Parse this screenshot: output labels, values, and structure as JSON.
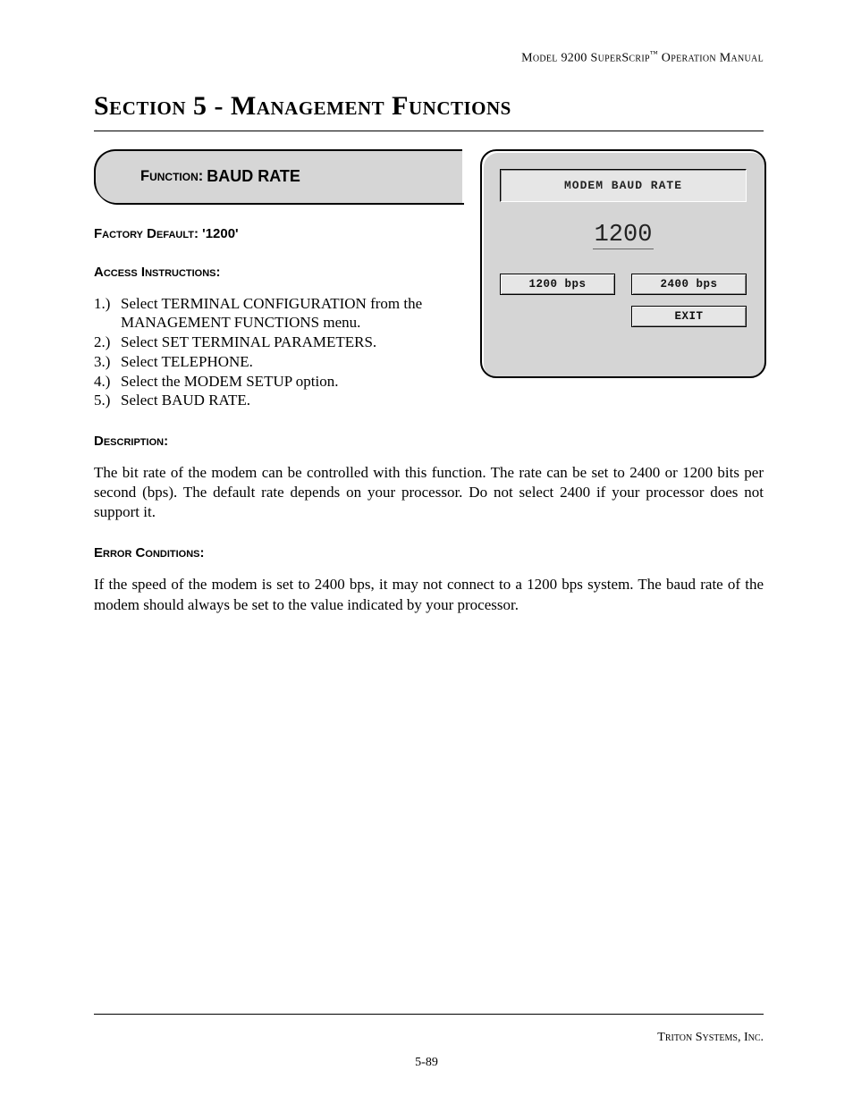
{
  "header": {
    "model": "Model 9200 SuperScrip",
    "tm": "™",
    "suffix": " Operation Manual"
  },
  "section_title": "Section 5 - Management Functions",
  "fn": {
    "label": "Function:  ",
    "name": "BAUD RATE"
  },
  "factory_default": {
    "label": "Factory Default: ",
    "value": "'1200'"
  },
  "access_label": "Access Instructions:",
  "instructions": [
    {
      "n": "1.)",
      "t": "Select TERMINAL CONFIGURATION from the MANAGEMENT FUNCTIONS menu."
    },
    {
      "n": "2.)",
      "t": "Select SET TERMINAL PARAMETERS."
    },
    {
      "n": "3.)",
      "t": "Select TELEPHONE."
    },
    {
      "n": "4.)",
      "t": "Select the MODEM SETUP option."
    },
    {
      "n": "5.)",
      "t": "Select BAUD RATE."
    }
  ],
  "description_label": "Description:",
  "description_text": "The bit rate of the modem can be controlled with this function.  The rate can be set to 2400 or 1200 bits per second (bps).  The default rate depends on your processor.  Do not select 2400 if your processor does not support it.",
  "error_label": "Error Conditions:",
  "error_text": "If the speed of the modem is set to 2400 bps, it may not connect to a 1200  bps system.  The baud rate of the modem should always be set to the value indicated by your processor.",
  "screen": {
    "title": "MODEM BAUD RATE",
    "value": "1200",
    "btn1": "1200 bps",
    "btn2": "2400 bps",
    "btn_exit": "EXIT"
  },
  "footer": {
    "company": "Triton Systems, Inc.",
    "page": "5-89"
  }
}
